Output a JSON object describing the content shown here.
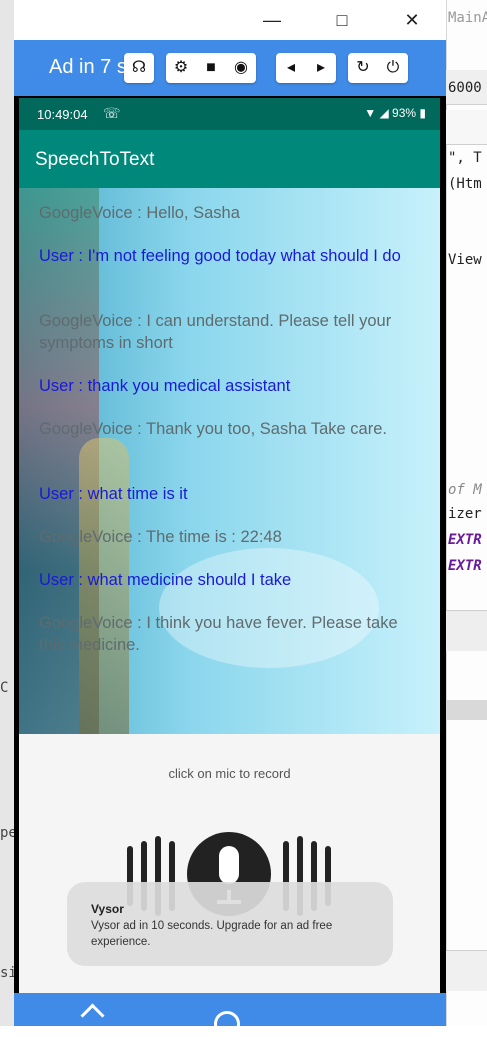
{
  "window": {
    "ad_text": "Ad in 7 s",
    "controls": [
      "headphones-icon",
      "gear-icon",
      "camera-video-icon",
      "camera-icon",
      "volume-down-icon",
      "volume-up-icon",
      "refresh-icon",
      "power-icon"
    ]
  },
  "ide_bg": {
    "top_right": "MainA",
    "code1": "6000",
    "code2": "\", T",
    "code3": "(Htm",
    "code4": "View",
    "code5": "of M",
    "code6": "izer",
    "code7": "EXTR",
    "code8": "EXTR",
    "left1": "C",
    "left2": "pe",
    "left3": "si"
  },
  "status": {
    "time": "10:49:04",
    "battery": "93%"
  },
  "app": {
    "title": "SpeechToText"
  },
  "messages": [
    {
      "speaker": "google",
      "text": "GoogleVoice : Hello, Sasha"
    },
    {
      "speaker": "user",
      "text": "User : I'm not feeling good today what should I do"
    },
    {
      "speaker": "google",
      "text": "GoogleVoice : I can understand. Please tell your symptoms in short"
    },
    {
      "speaker": "user",
      "text": "User : thank you medical assistant"
    },
    {
      "speaker": "google",
      "text": "GoogleVoice : Thank you too, Sasha Take care."
    },
    {
      "speaker": "user",
      "text": "User : what time is it"
    },
    {
      "speaker": "google",
      "text": "GoogleVoice : The time is : 22:48"
    },
    {
      "speaker": "user",
      "text": "User : what medicine should I take"
    },
    {
      "speaker": "google",
      "text": "GoogleVoice : I think you have fever. Please take this medicine."
    }
  ],
  "record": {
    "hint": "click on mic to record"
  },
  "toast": {
    "title": "Vysor",
    "body": "Vysor ad in 10 seconds. Upgrade for an ad free experience."
  },
  "colors": {
    "toolbar": "#3f8be7",
    "statusbar": "#00695c",
    "appbar": "#00897b",
    "user_text": "#1a1ad6",
    "google_text": "#5f6b6e"
  }
}
